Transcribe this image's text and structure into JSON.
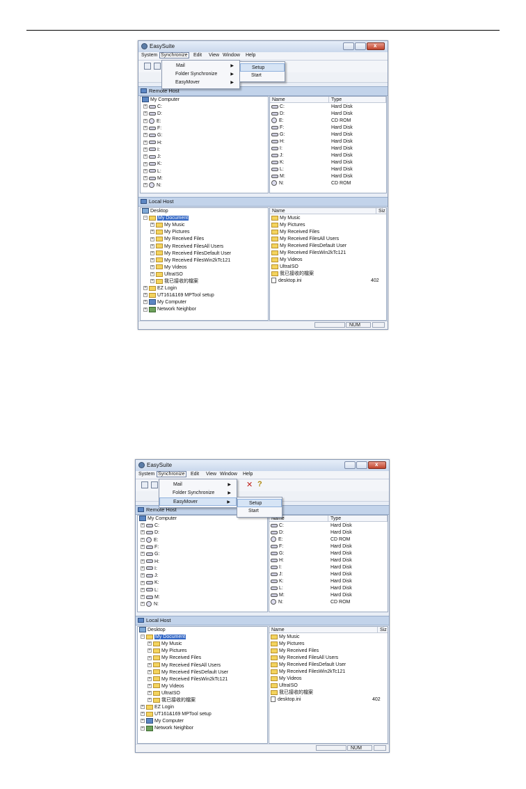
{
  "screenshots": [
    {
      "window_title": "EasySuite",
      "menu": [
        "System",
        "Synchronize",
        "Edit",
        "View",
        "Window",
        "Help"
      ],
      "active_menu": "Synchronize",
      "dropdown": {
        "items": [
          {
            "label": "Mail",
            "has_submenu": true
          },
          {
            "label": "Folder Synchronize",
            "has_submenu": true
          },
          {
            "label": "EasyMover",
            "has_submenu": true
          }
        ],
        "open_submenu_of": "Mail",
        "submenu": [
          "Setup",
          "Start"
        ]
      },
      "remote_host": {
        "title": "Remote Host",
        "tree_root": "My Computer",
        "drives": [
          "C:",
          "D:",
          "E:",
          "F:",
          "G:",
          "H:",
          "I:",
          "J:",
          "K:",
          "L:",
          "M:",
          "N:"
        ],
        "list_columns": [
          "Name",
          "Type"
        ],
        "list": [
          {
            "name": "C:",
            "type": "Hard Disk"
          },
          {
            "name": "D:",
            "type": "Hard Disk"
          },
          {
            "name": "E:",
            "type": "CD ROM"
          },
          {
            "name": "F:",
            "type": "Hard Disk"
          },
          {
            "name": "G:",
            "type": "Hard Disk"
          },
          {
            "name": "H:",
            "type": "Hard Disk"
          },
          {
            "name": "I:",
            "type": "Hard Disk"
          },
          {
            "name": "J:",
            "type": "Hard Disk"
          },
          {
            "name": "K:",
            "type": "Hard Disk"
          },
          {
            "name": "L:",
            "type": "Hard Disk"
          },
          {
            "name": "M:",
            "type": "Hard Disk"
          },
          {
            "name": "N:",
            "type": "CD ROM"
          }
        ]
      },
      "local_host": {
        "title": "Local Host",
        "tree": [
          {
            "label": "Desktop",
            "level": 0
          },
          {
            "label": "My Document",
            "level": 1,
            "selected": true
          },
          {
            "label": "My Music",
            "level": 2
          },
          {
            "label": "My Pictures",
            "level": 2
          },
          {
            "label": "My Received Files",
            "level": 2
          },
          {
            "label": "My Received FilesAll Users",
            "level": 2
          },
          {
            "label": "My Received FilesDefault User",
            "level": 2
          },
          {
            "label": "My Received FilesWin2kTc121",
            "level": 2
          },
          {
            "label": "My Videos",
            "level": 2
          },
          {
            "label": "UltraISO",
            "level": 2
          },
          {
            "label": "我已接收的檔案",
            "level": 2
          },
          {
            "label": "EZ Login",
            "level": 1
          },
          {
            "label": "UT161&169 MPTool setup",
            "level": 1
          },
          {
            "label": "My Computer",
            "level": 1
          },
          {
            "label": "Network Neighbor",
            "level": 1
          }
        ],
        "list_columns": [
          "Name",
          "Siz"
        ],
        "list": [
          {
            "name": "My Music",
            "size": ""
          },
          {
            "name": "My Pictures",
            "size": ""
          },
          {
            "name": "My Received Files",
            "size": ""
          },
          {
            "name": "My Received FilesAll Users",
            "size": ""
          },
          {
            "name": "My Received FilesDefault User",
            "size": ""
          },
          {
            "name": "My Received FilesWin2kTc121",
            "size": ""
          },
          {
            "name": "My Videos",
            "size": ""
          },
          {
            "name": "UltraISO",
            "size": ""
          },
          {
            "name": "我已接收的檔案",
            "size": ""
          },
          {
            "name": "desktop.ini",
            "size": "402"
          }
        ]
      },
      "status": "NUM"
    },
    {
      "window_title": "EasySuite",
      "menu": [
        "System",
        "Synchronize",
        "Edit",
        "View",
        "Window",
        "Help"
      ],
      "active_menu": "Synchronize",
      "dropdown": {
        "items": [
          {
            "label": "Mail",
            "has_submenu": true
          },
          {
            "label": "Folder Synchronize",
            "has_submenu": true
          },
          {
            "label": "EasyMover",
            "has_submenu": true
          }
        ],
        "open_submenu_of": "EasyMover",
        "submenu": [
          "Setup",
          "Start"
        ]
      },
      "remote_host": {
        "title": "Remote Host",
        "tree_root": "My Computer",
        "drives": [
          "C:",
          "D:",
          "E:",
          "F:",
          "G:",
          "H:",
          "I:",
          "J:",
          "K:",
          "L:",
          "M:",
          "N:"
        ],
        "list_columns": [
          "Name",
          "Type"
        ],
        "list": [
          {
            "name": "C:",
            "type": "Hard Disk"
          },
          {
            "name": "D:",
            "type": "Hard Disk"
          },
          {
            "name": "E:",
            "type": "CD ROM"
          },
          {
            "name": "F:",
            "type": "Hard Disk"
          },
          {
            "name": "G:",
            "type": "Hard Disk"
          },
          {
            "name": "H:",
            "type": "Hard Disk"
          },
          {
            "name": "I:",
            "type": "Hard Disk"
          },
          {
            "name": "J:",
            "type": "Hard Disk"
          },
          {
            "name": "K:",
            "type": "Hard Disk"
          },
          {
            "name": "L:",
            "type": "Hard Disk"
          },
          {
            "name": "M:",
            "type": "Hard Disk"
          },
          {
            "name": "N:",
            "type": "CD ROM"
          }
        ]
      },
      "local_host": {
        "title": "Local Host",
        "tree": [
          {
            "label": "Desktop",
            "level": 0
          },
          {
            "label": "My Document",
            "level": 1,
            "selected": true
          },
          {
            "label": "My Music",
            "level": 2
          },
          {
            "label": "My Pictures",
            "level": 2
          },
          {
            "label": "My Received Files",
            "level": 2
          },
          {
            "label": "My Received FilesAll Users",
            "level": 2
          },
          {
            "label": "My Received FilesDefault User",
            "level": 2
          },
          {
            "label": "My Received FilesWin2kTc121",
            "level": 2
          },
          {
            "label": "My Videos",
            "level": 2
          },
          {
            "label": "UltraISO",
            "level": 2
          },
          {
            "label": "我已接收的檔案",
            "level": 2
          },
          {
            "label": "EZ Login",
            "level": 1
          },
          {
            "label": "UT161&169 MPTool setup",
            "level": 1
          },
          {
            "label": "My Computer",
            "level": 1
          },
          {
            "label": "Network Neighbor",
            "level": 1
          }
        ],
        "list_columns": [
          "Name",
          "Siz"
        ],
        "list": [
          {
            "name": "My Music",
            "size": ""
          },
          {
            "name": "My Pictures",
            "size": ""
          },
          {
            "name": "My Received Files",
            "size": ""
          },
          {
            "name": "My Received FilesAll Users",
            "size": ""
          },
          {
            "name": "My Received FilesDefault User",
            "size": ""
          },
          {
            "name": "My Received FilesWin2kTc121",
            "size": ""
          },
          {
            "name": "My Videos",
            "size": ""
          },
          {
            "name": "UltraISO",
            "size": ""
          },
          {
            "name": "我已接收的檔案",
            "size": ""
          },
          {
            "name": "desktop.ini",
            "size": "402"
          }
        ]
      },
      "status": "NUM"
    }
  ]
}
